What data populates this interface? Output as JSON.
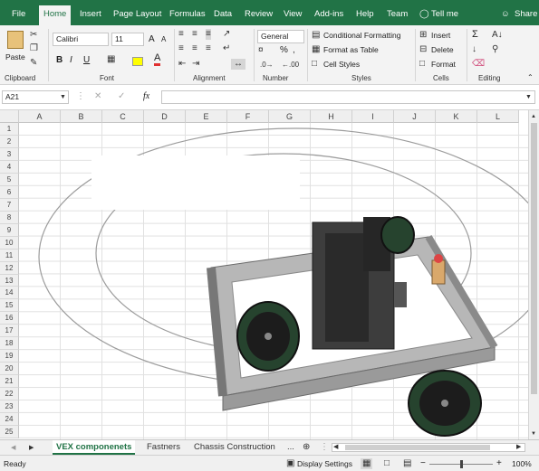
{
  "ribbon_tabs": [
    "File",
    "Home",
    "Insert",
    "Page Layout",
    "Formulas",
    "Data",
    "Review",
    "View",
    "Add-ins",
    "Help",
    "Team",
    "Tell me",
    "Share"
  ],
  "clipboard": {
    "paste": "Paste",
    "label": "Clipboard"
  },
  "font": {
    "name": "Calibri",
    "size": "11",
    "bold": "B",
    "italic": "I",
    "underline": "U",
    "label": "Font",
    "grow": "A",
    "shrink": "A",
    "color_letter": "A"
  },
  "alignment": {
    "label": "Alignment"
  },
  "number": {
    "format": "General",
    "percent": "%",
    "label": "Number"
  },
  "styles": {
    "conditional": "Conditional Formatting",
    "format_table": "Format as Table",
    "cell_styles": "Cell Styles",
    "label": "Styles"
  },
  "cells": {
    "insert": "Insert",
    "delete": "Delete",
    "format": "Format",
    "label": "Cells"
  },
  "editing": {
    "label": "Editing",
    "sum": "Σ"
  },
  "formula_bar": {
    "name_box": "A21",
    "fx": "fx",
    "value": ""
  },
  "columns": [
    "A",
    "B",
    "C",
    "D",
    "E",
    "F",
    "G",
    "H",
    "I",
    "J",
    "K",
    "L"
  ],
  "rows": [
    "1",
    "2",
    "3",
    "4",
    "5",
    "6",
    "7",
    "8",
    "9",
    "10",
    "11",
    "12",
    "13",
    "14",
    "15",
    "16",
    "17",
    "18",
    "19",
    "20",
    "21",
    "22",
    "23",
    "24",
    "25"
  ],
  "sheets": [
    "VEX componenets",
    "Fastners",
    "Chassis Construction",
    "..."
  ],
  "status": {
    "ready": "Ready",
    "display": "Display Settings",
    "zoom": "100%",
    "minus": "−",
    "plus": "+"
  },
  "colors": {
    "brand": "#217346"
  }
}
